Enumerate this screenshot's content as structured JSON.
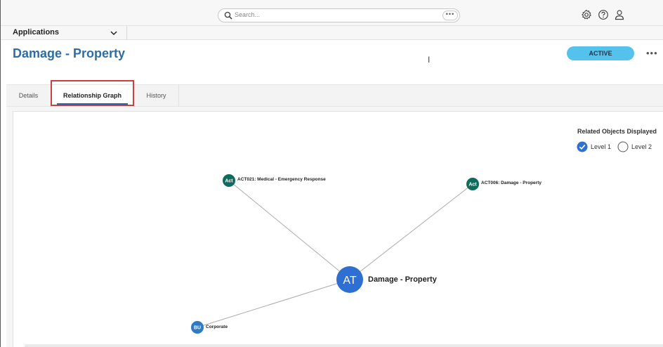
{
  "search": {
    "placeholder": "Search...",
    "more": "•••"
  },
  "topbar_icons": [
    "gear-icon",
    "help-icon",
    "user-icon"
  ],
  "applications": {
    "label": "Applications"
  },
  "page": {
    "title": "Damage - Property",
    "status": "ACTIVE",
    "more": "•••"
  },
  "tabs": [
    {
      "label": "Details",
      "active": false
    },
    {
      "label": "Relationship Graph",
      "active": true
    },
    {
      "label": "History",
      "active": false
    }
  ],
  "legend": {
    "title": "Related Objects Displayed",
    "level1": "Level 1",
    "level1_checked": true,
    "level2": "Level 2",
    "level2_checked": false
  },
  "graph": {
    "center": {
      "badge": "AT",
      "label": "Damage - Property",
      "color": "#2f6fd1"
    },
    "nodes": [
      {
        "badge": "Act",
        "label": "ACT021: Medical - Emergency Response",
        "color": "#0f6b5c"
      },
      {
        "badge": "Act",
        "label": "ACT006: Damage - Property",
        "color": "#0f6b5c"
      },
      {
        "badge": "BU",
        "label": "Corporate",
        "color": "#2f7ac0"
      }
    ]
  },
  "colors": {
    "accent": "#2e6da4",
    "status": "#55c1ed",
    "highlight": "#c94040",
    "edge": "#aaaaaa"
  }
}
